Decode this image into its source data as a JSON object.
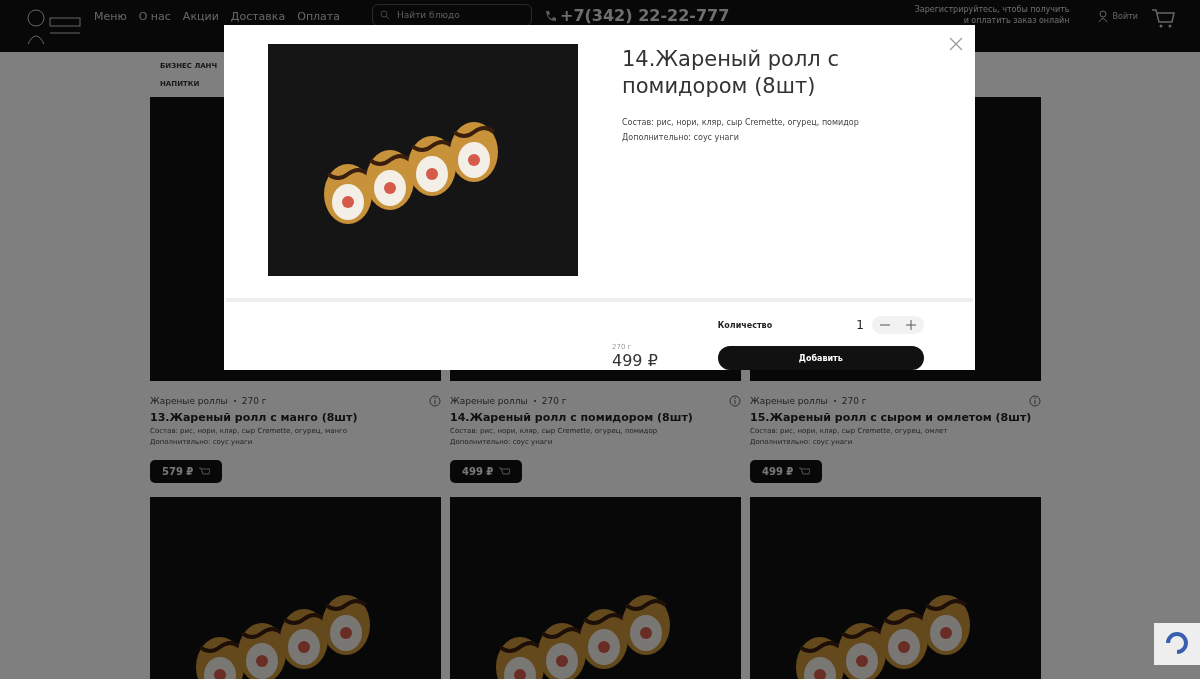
{
  "header": {
    "nav": [
      "Меню",
      "О нас",
      "Акции",
      "Доставка",
      "Оплата"
    ],
    "search": {
      "placeholder": "Найти блюдо"
    },
    "phone": "+7(342) 22-22-777",
    "register_note": [
      "Зарегистрируйтесь, чтобы получить",
      "и оплатить заказ онлайн"
    ],
    "login": "Войти"
  },
  "categories": [
    "БИЗНЕС ЛАНЧ",
    "НАПИТКИ"
  ],
  "products": [
    {
      "category": "Жареные роллы",
      "weight": "270 г",
      "title": "13.Жареный ролл с манго (8шт)",
      "composition": "Состав: рис, нори, кляр, сыр Cremette, огурец, манго",
      "extra": "Дополнительно: соус унаги",
      "price": "579 ₽"
    },
    {
      "category": "Жареные роллы",
      "weight": "270 г",
      "title": "14.Жареный ролл с помидором (8шт)",
      "composition": "Состав: рис, нори, кляр, сыр Cremette,  огурец, помидор",
      "extra": "Дополнительно: соус унаги",
      "price": "499 ₽"
    },
    {
      "category": "Жареные роллы",
      "weight": "270 г",
      "title": "15.Жареный ролл с сыром и омлетом (8шт)",
      "composition": "Состав: рис, нори, кляр, сыр Cremette, огурец, омлет",
      "extra": "Дополнительно: соус унаги",
      "price": "499 ₽"
    }
  ],
  "modal": {
    "title": "14.Жареный ролл с помидором (8шт)",
    "composition": "Состав: рис, нори, кляр, сыр Cremette,  огурец, помидор",
    "extra": "Дополнительно: соус унаги",
    "weight": "270 г",
    "price": "499 ₽",
    "quantity_label": "Количество",
    "quantity": "1",
    "add_button": "Добавить"
  }
}
